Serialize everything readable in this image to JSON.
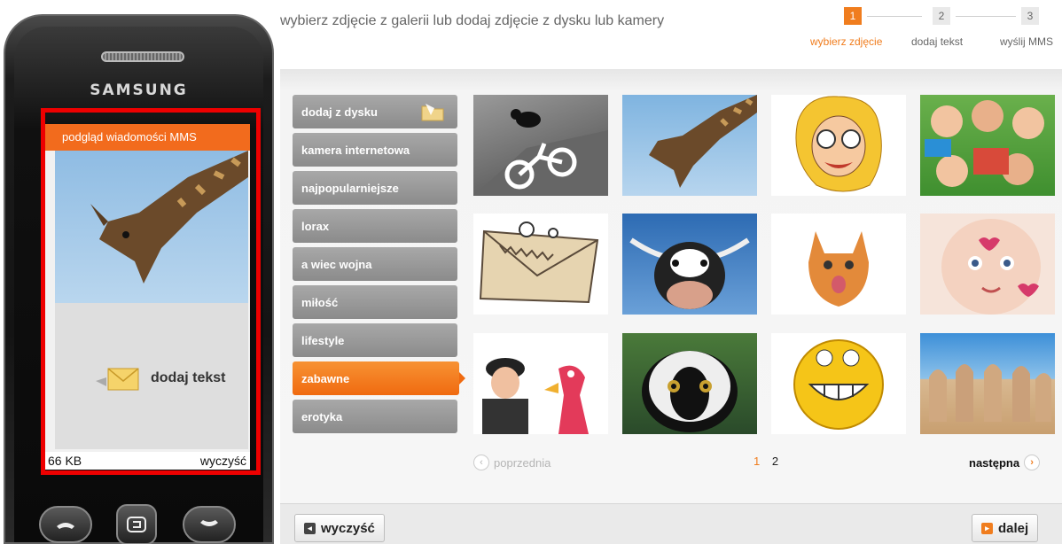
{
  "instructions": "wybierz zdjęcie z galerii lub dodaj zdjęcie z dysku lub kamery",
  "steps": [
    {
      "num": "1",
      "label": "wybierz zdjęcie",
      "active": true
    },
    {
      "num": "2",
      "label": "dodaj tekst",
      "active": false
    },
    {
      "num": "3",
      "label": "wyślij MMS",
      "active": false
    }
  ],
  "phone": {
    "brand": "SAMSUNG",
    "preview_title": "podgląd wiadomości MMS",
    "add_text_label": "dodaj tekst",
    "size": "66 KB",
    "clear_label": "wyczyść"
  },
  "categories": [
    {
      "label": "dodaj z dysku",
      "active": false
    },
    {
      "label": "kamera internetowa",
      "active": false
    },
    {
      "label": "najpopularniejsze",
      "active": false
    },
    {
      "label": "lorax",
      "active": false
    },
    {
      "label": "a wiec wojna",
      "active": false
    },
    {
      "label": "miłość",
      "active": false
    },
    {
      "label": "lifestyle",
      "active": false
    },
    {
      "label": "zabawne",
      "active": true
    },
    {
      "label": "erotyka",
      "active": false
    }
  ],
  "thumbnails": [
    "dog-on-bicycle-lane-photo",
    "giraffe-photo",
    "cartoon-woman-glasses",
    "kids-circle-photo",
    "envelope-monster-drawing",
    "cow-photo",
    "kitten-photo",
    "baby-with-kisses-photo",
    "man-with-puppet-photo",
    "lemur-photo",
    "smiley-face-drawing",
    "feet-on-beach-photo"
  ],
  "pager": {
    "prev": "poprzednia",
    "pages": [
      "1",
      "2"
    ],
    "current": "1",
    "next": "następna"
  },
  "buttons": {
    "clear": "wyczyść",
    "next": "dalej"
  },
  "colors": {
    "accent": "#f07d1e",
    "frame": "#ee0000"
  }
}
